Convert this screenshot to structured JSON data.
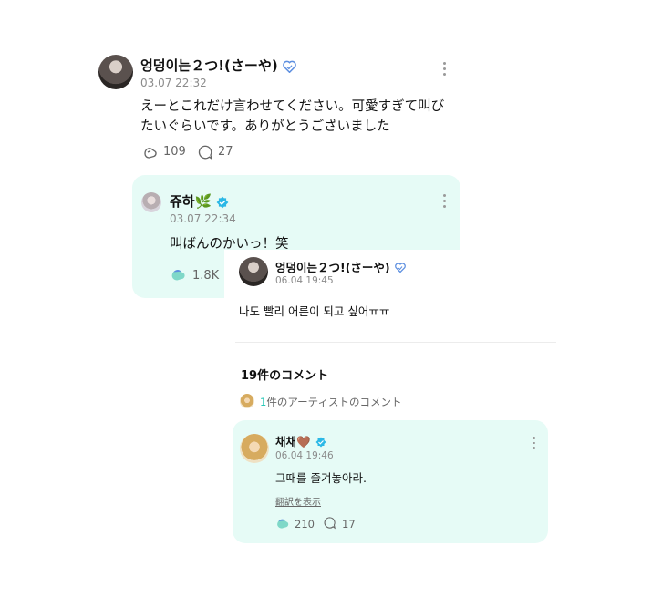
{
  "post": {
    "author": "엉덩이는２つ!(さーや)",
    "date": "03.07 22:32",
    "text_line1": "えーとこれだけ言わせてください。可愛すぎて叫び",
    "text_line2": "たいぐらいです。ありがとうございました",
    "likes": "109",
    "comments": "27"
  },
  "reply": {
    "author": "쥬하🌿",
    "date": "03.07 22:34",
    "text": "叫ばんのかいっ！笑",
    "likes": "1.8K"
  },
  "overlay": {
    "post": {
      "author": "엉덩이는２つ!(さーや)",
      "date": "06.04 19:45",
      "text": "나도 빨리 어른이 되고 싶어ㅠㅠ"
    },
    "comments_header": "19件のコメント",
    "artist_count": "1",
    "artist_label": "件のアーティストのコメント",
    "artist_comment": {
      "author": "채채🤎",
      "date": "06.04 19:46",
      "text": "그때를 즐겨놓아라.",
      "translate_link": "翻訳を表示",
      "likes": "210",
      "comments": "17"
    }
  },
  "colors": {
    "mint_bg": "#e6fbf6",
    "verified_blue": "#2bb8e6",
    "heart_blue": "#5d8fe0",
    "accent_teal": "#28c7b7"
  },
  "icons": [
    "verified-heart-icon",
    "verified-badge-icon",
    "like-icon",
    "comment-icon",
    "more-icon"
  ]
}
